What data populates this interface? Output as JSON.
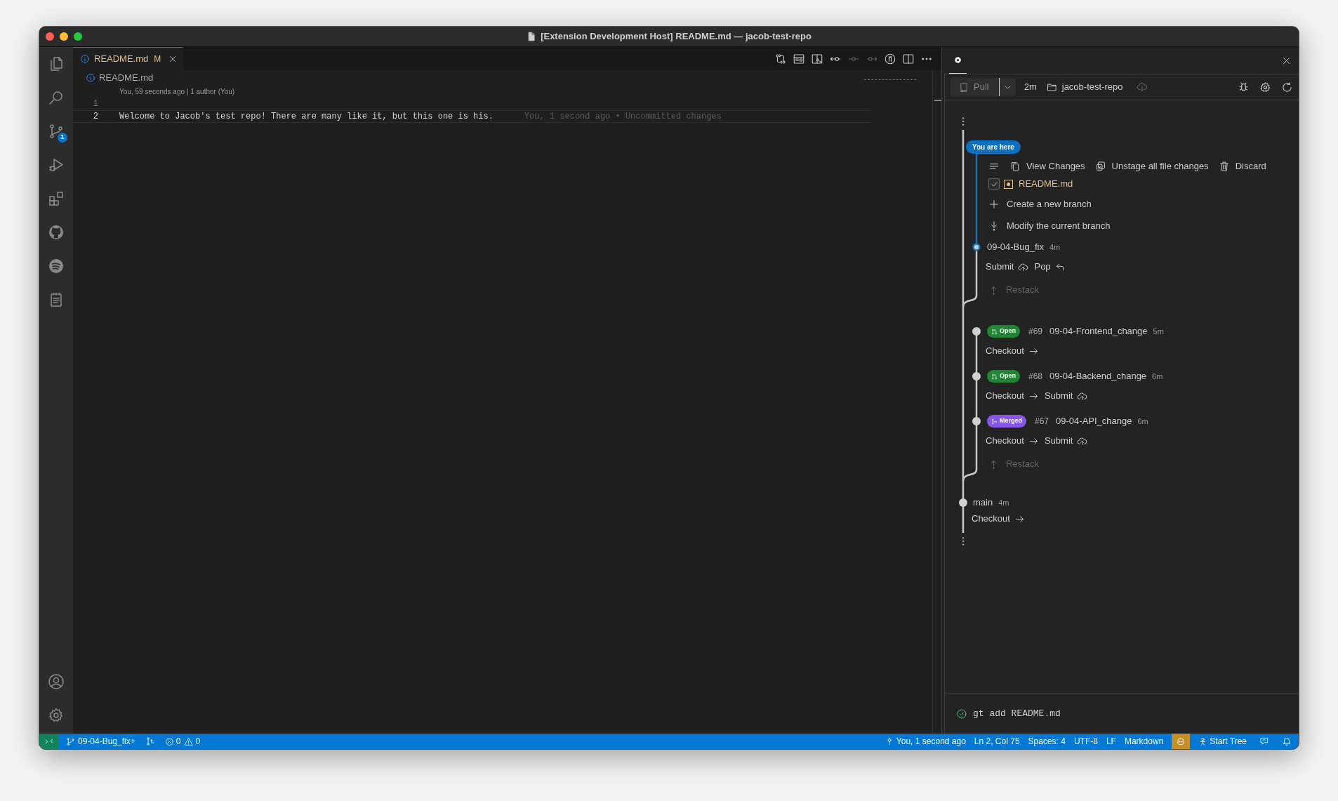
{
  "window": {
    "title": "[Extension Development Host] README.md — jacob-test-repo"
  },
  "activity_bar": {
    "source_control_badge": "1"
  },
  "editor": {
    "tabs": [
      {
        "label": "README.md",
        "status": "M",
        "selected": true
      }
    ],
    "breadcrumb": "README.md",
    "blame_header": "You, 59 seconds ago | 1 author (You)",
    "lines": [
      {
        "number": "1",
        "current": false
      },
      {
        "number": "2",
        "current": true,
        "text": "Welcome to Jacob's test repo! There are many like it, but this one is his.",
        "annotation": "You, 1 second ago • Uncommitted changes"
      }
    ]
  },
  "panel": {
    "tabs": [
      {
        "selected": true
      }
    ],
    "toolbar": {
      "pull": "Pull",
      "age": "2m",
      "repo": "jacob-test-repo"
    },
    "graph": [
      {
        "kind": "more"
      },
      {
        "kind": "here",
        "label": "You are here"
      },
      {
        "kind": "actions",
        "actions": [
          {
            "kind": "view",
            "label": "View Changes"
          },
          {
            "kind": "unstage",
            "label": "Unstage all file changes"
          },
          {
            "kind": "discard",
            "label": "Discard"
          }
        ]
      },
      {
        "kind": "file",
        "name": "README.md",
        "checked": true
      },
      {
        "kind": "create",
        "label": "Create a new branch"
      },
      {
        "kind": "modify",
        "label": "Modify the current branch"
      },
      {
        "kind": "stack_branch",
        "name": "09-04-Bug_fix",
        "age": "4m",
        "current": true
      },
      {
        "kind": "stack_links",
        "links": [
          {
            "kind": "submit",
            "label": "Submit"
          },
          {
            "kind": "pop",
            "label": "Pop"
          }
        ]
      },
      {
        "kind": "restack",
        "label": "Restack",
        "disabled": true
      },
      {
        "kind": "stack_branch",
        "merged": false,
        "status": "Open",
        "number": "#69",
        "name": "09-04-Frontend_change",
        "age": "5m",
        "current": false
      },
      {
        "kind": "stack_links",
        "links": [
          {
            "kind": "checkout",
            "label": "Checkout"
          }
        ]
      },
      {
        "kind": "stack_branch",
        "merged": false,
        "status": "Open",
        "number": "#68",
        "name": "09-04-Backend_change",
        "age": "6m",
        "current": false
      },
      {
        "kind": "stack_links",
        "links": [
          {
            "kind": "checkout",
            "label": "Checkout"
          },
          {
            "kind": "submit",
            "label": "Submit"
          }
        ]
      },
      {
        "kind": "stack_branch",
        "merged": true,
        "status": "Merged",
        "number": "#67",
        "name": "09-04-API_change",
        "age": "6m",
        "current": false
      },
      {
        "kind": "stack_links",
        "links": [
          {
            "kind": "checkout",
            "label": "Checkout"
          },
          {
            "kind": "submit",
            "label": "Submit"
          }
        ]
      },
      {
        "kind": "restack",
        "label": "Restack",
        "disabled": true
      },
      {
        "kind": "trunk_branch",
        "name": "main",
        "age": "4m",
        "current": false
      },
      {
        "kind": "trunk_links",
        "links": [
          {
            "kind": "checkout",
            "label": "Checkout"
          }
        ]
      },
      {
        "kind": "more"
      }
    ],
    "log": {
      "done": true,
      "command": "gt add README.md"
    }
  },
  "status_bar": {
    "left": [
      {
        "kind": "remote"
      },
      {
        "kind": "branch",
        "label": "09-04-Bug_fix+"
      },
      {
        "kind": "sync"
      },
      {
        "kind": "problems",
        "errors": "0",
        "warnings": "0"
      }
    ],
    "right": [
      {
        "kind": "blame",
        "label": "You, 1 second ago"
      },
      {
        "kind": "text",
        "label": "Ln 2, Col 75"
      },
      {
        "kind": "text",
        "label": "Spaces: 4"
      },
      {
        "kind": "text",
        "label": "UTF-8"
      },
      {
        "kind": "text",
        "label": "LF"
      },
      {
        "kind": "text",
        "label": "Markdown"
      },
      {
        "kind": "copilot"
      },
      {
        "kind": "tree",
        "label": "Start Tree"
      },
      {
        "kind": "feedback"
      },
      {
        "kind": "bell"
      }
    ]
  }
}
